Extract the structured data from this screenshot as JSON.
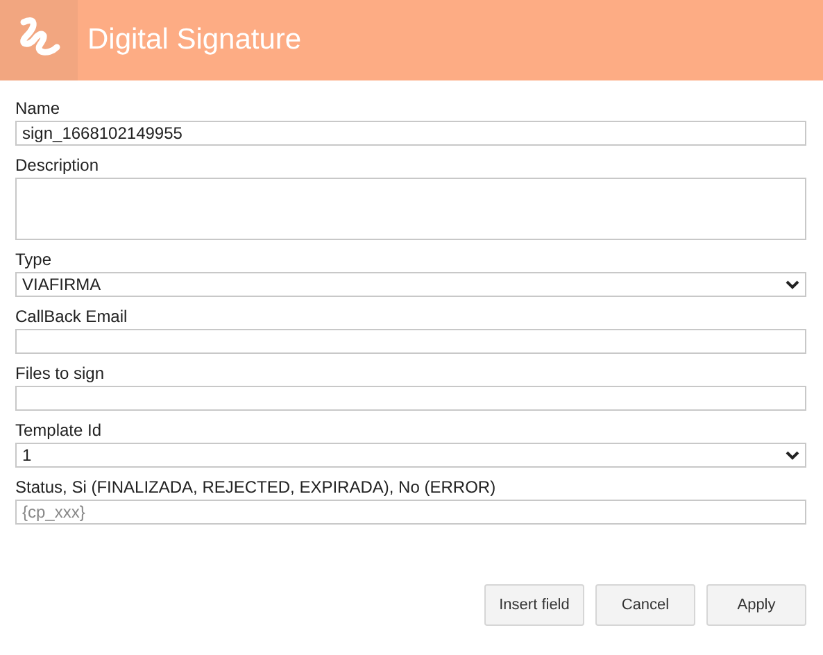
{
  "window": {
    "title": "Digital Signature"
  },
  "fields": [
    {
      "label": "Name",
      "kind": "text",
      "value": "sign_1668102149955"
    },
    {
      "label": "Description",
      "kind": "textarea"
    },
    {
      "label": "Type",
      "kind": "select",
      "value": "VIAFIRMA"
    },
    {
      "label": "CallBack Email",
      "kind": "text"
    },
    {
      "label": "Files to sign",
      "kind": "text"
    },
    {
      "label": "Template Id",
      "kind": "select",
      "value": "1"
    },
    {
      "label": "Status, Si (FINALIZADA, REJECTED, EXPIRADA), No (ERROR)",
      "kind": "text",
      "placeholder": "{cp_xxx}"
    }
  ],
  "buttons": [
    "Insert field",
    "Cancel",
    "Apply"
  ]
}
